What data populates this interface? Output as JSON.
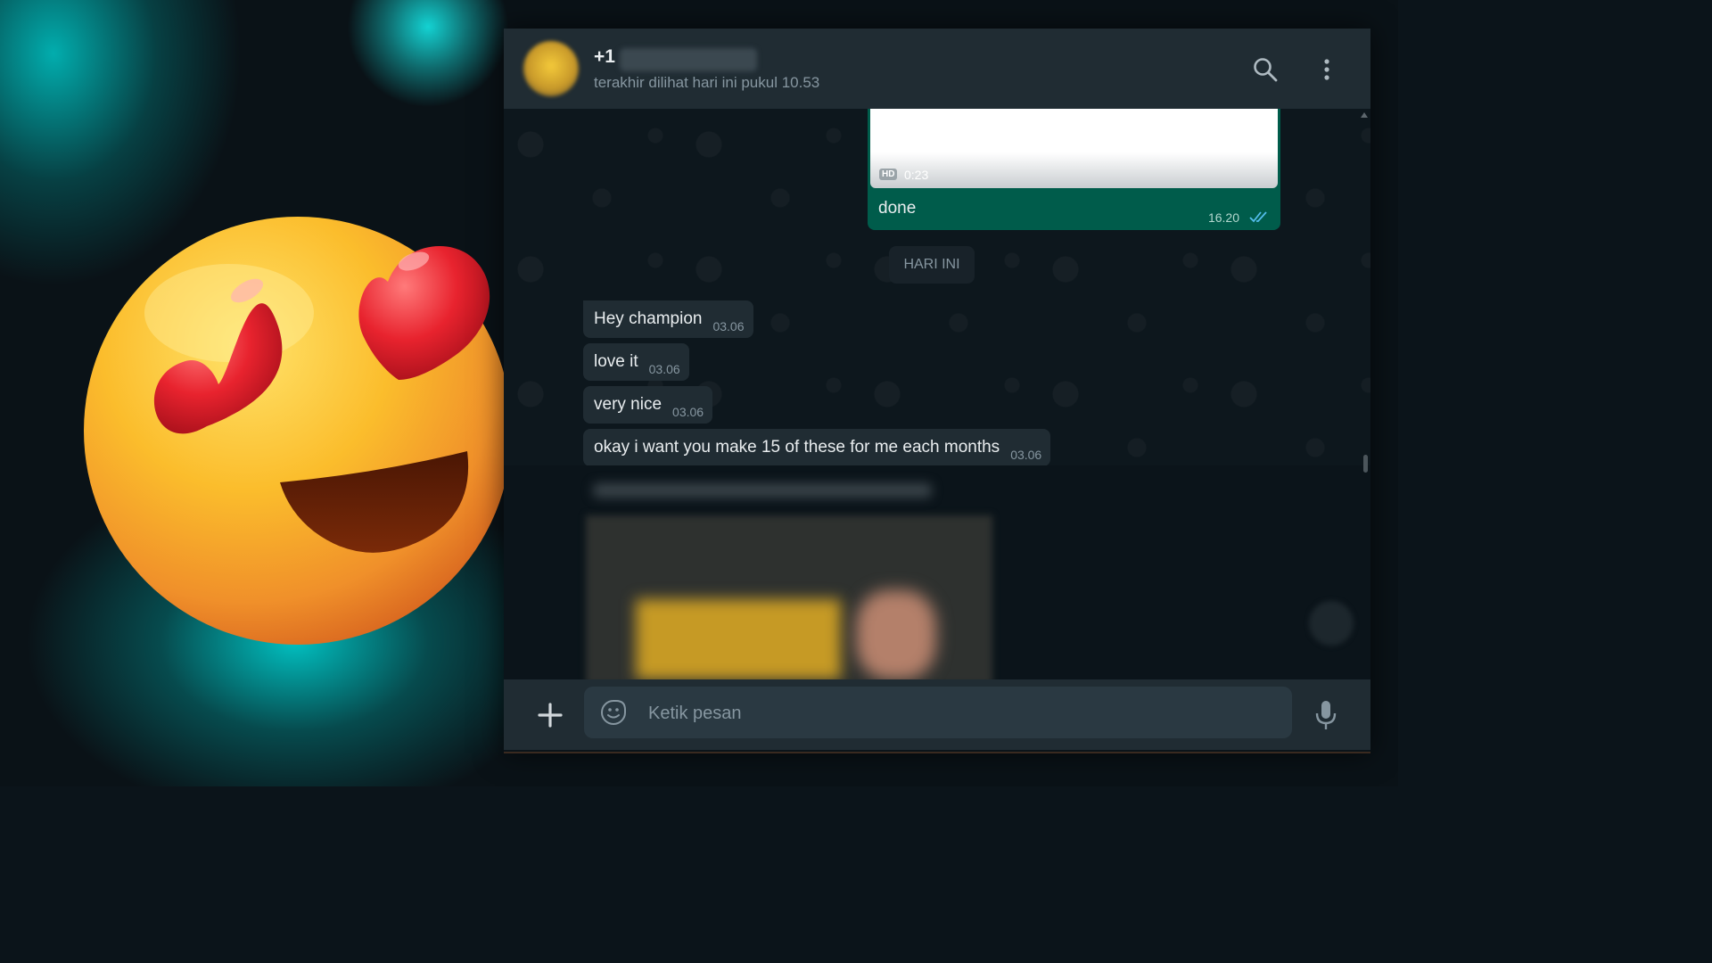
{
  "chat": {
    "contact": {
      "name_prefix": "+1",
      "last_seen": "terakhir dilihat hari ini pukul 10.53"
    },
    "header_icons": [
      "search-icon",
      "menu-dots-icon"
    ],
    "outgoing": {
      "hd_label": "HD",
      "duration": "0:23",
      "text": "done",
      "time": "16.20",
      "status": "read"
    },
    "date_divider": "HARI INI",
    "incoming": [
      {
        "text": "Hey champion",
        "time": "03.06"
      },
      {
        "text": "love it",
        "time": "03.06"
      },
      {
        "text": "very nice",
        "time": "03.06"
      },
      {
        "text": "okay i want you make 15 of these for me each months",
        "time": "03.06"
      }
    ],
    "composer": {
      "placeholder": "Ketik pesan",
      "icons": [
        "plus-icon",
        "sticker-icon",
        "mic-icon"
      ]
    }
  },
  "colors": {
    "outgoing_bubble": "#005c4b",
    "incoming_bubble": "#202c33",
    "header": "#202c33",
    "accent_glow": "#14dcdc"
  },
  "decoration": {
    "emoji": "heart-eyes-emoji"
  }
}
